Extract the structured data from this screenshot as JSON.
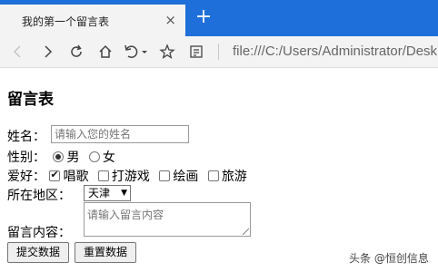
{
  "browser": {
    "tab_title": "我的第一个留言表",
    "tab_close": "×",
    "new_tab": "+",
    "address": "file:///C:/Users/Administrator/Desk"
  },
  "page": {
    "title": "留言表",
    "name_label": "姓名：",
    "name_placeholder": "请输入您的姓名",
    "gender_label": "性别：",
    "gender_options": [
      "男",
      "女"
    ],
    "gender_selected": "男",
    "hobby_label": "爱好：",
    "hobby_options": [
      "唱歌",
      "打游戏",
      "绘画",
      "旅游"
    ],
    "hobby_checked": [
      "唱歌"
    ],
    "region_label": "所在地区：",
    "region_value": "天津",
    "message_label": "留言内容：",
    "message_placeholder": "请输入留言内容",
    "submit_label": "提交数据",
    "reset_label": "重置数据"
  },
  "watermark": {
    "text": "头条 @恒创信息"
  },
  "icons": {
    "back": "arrow-left-icon",
    "forward": "arrow-right-icon",
    "reload": "reload-icon",
    "home": "home-icon",
    "undo": "undo-icon",
    "favorite": "star-icon",
    "reading": "reading-list-icon"
  }
}
